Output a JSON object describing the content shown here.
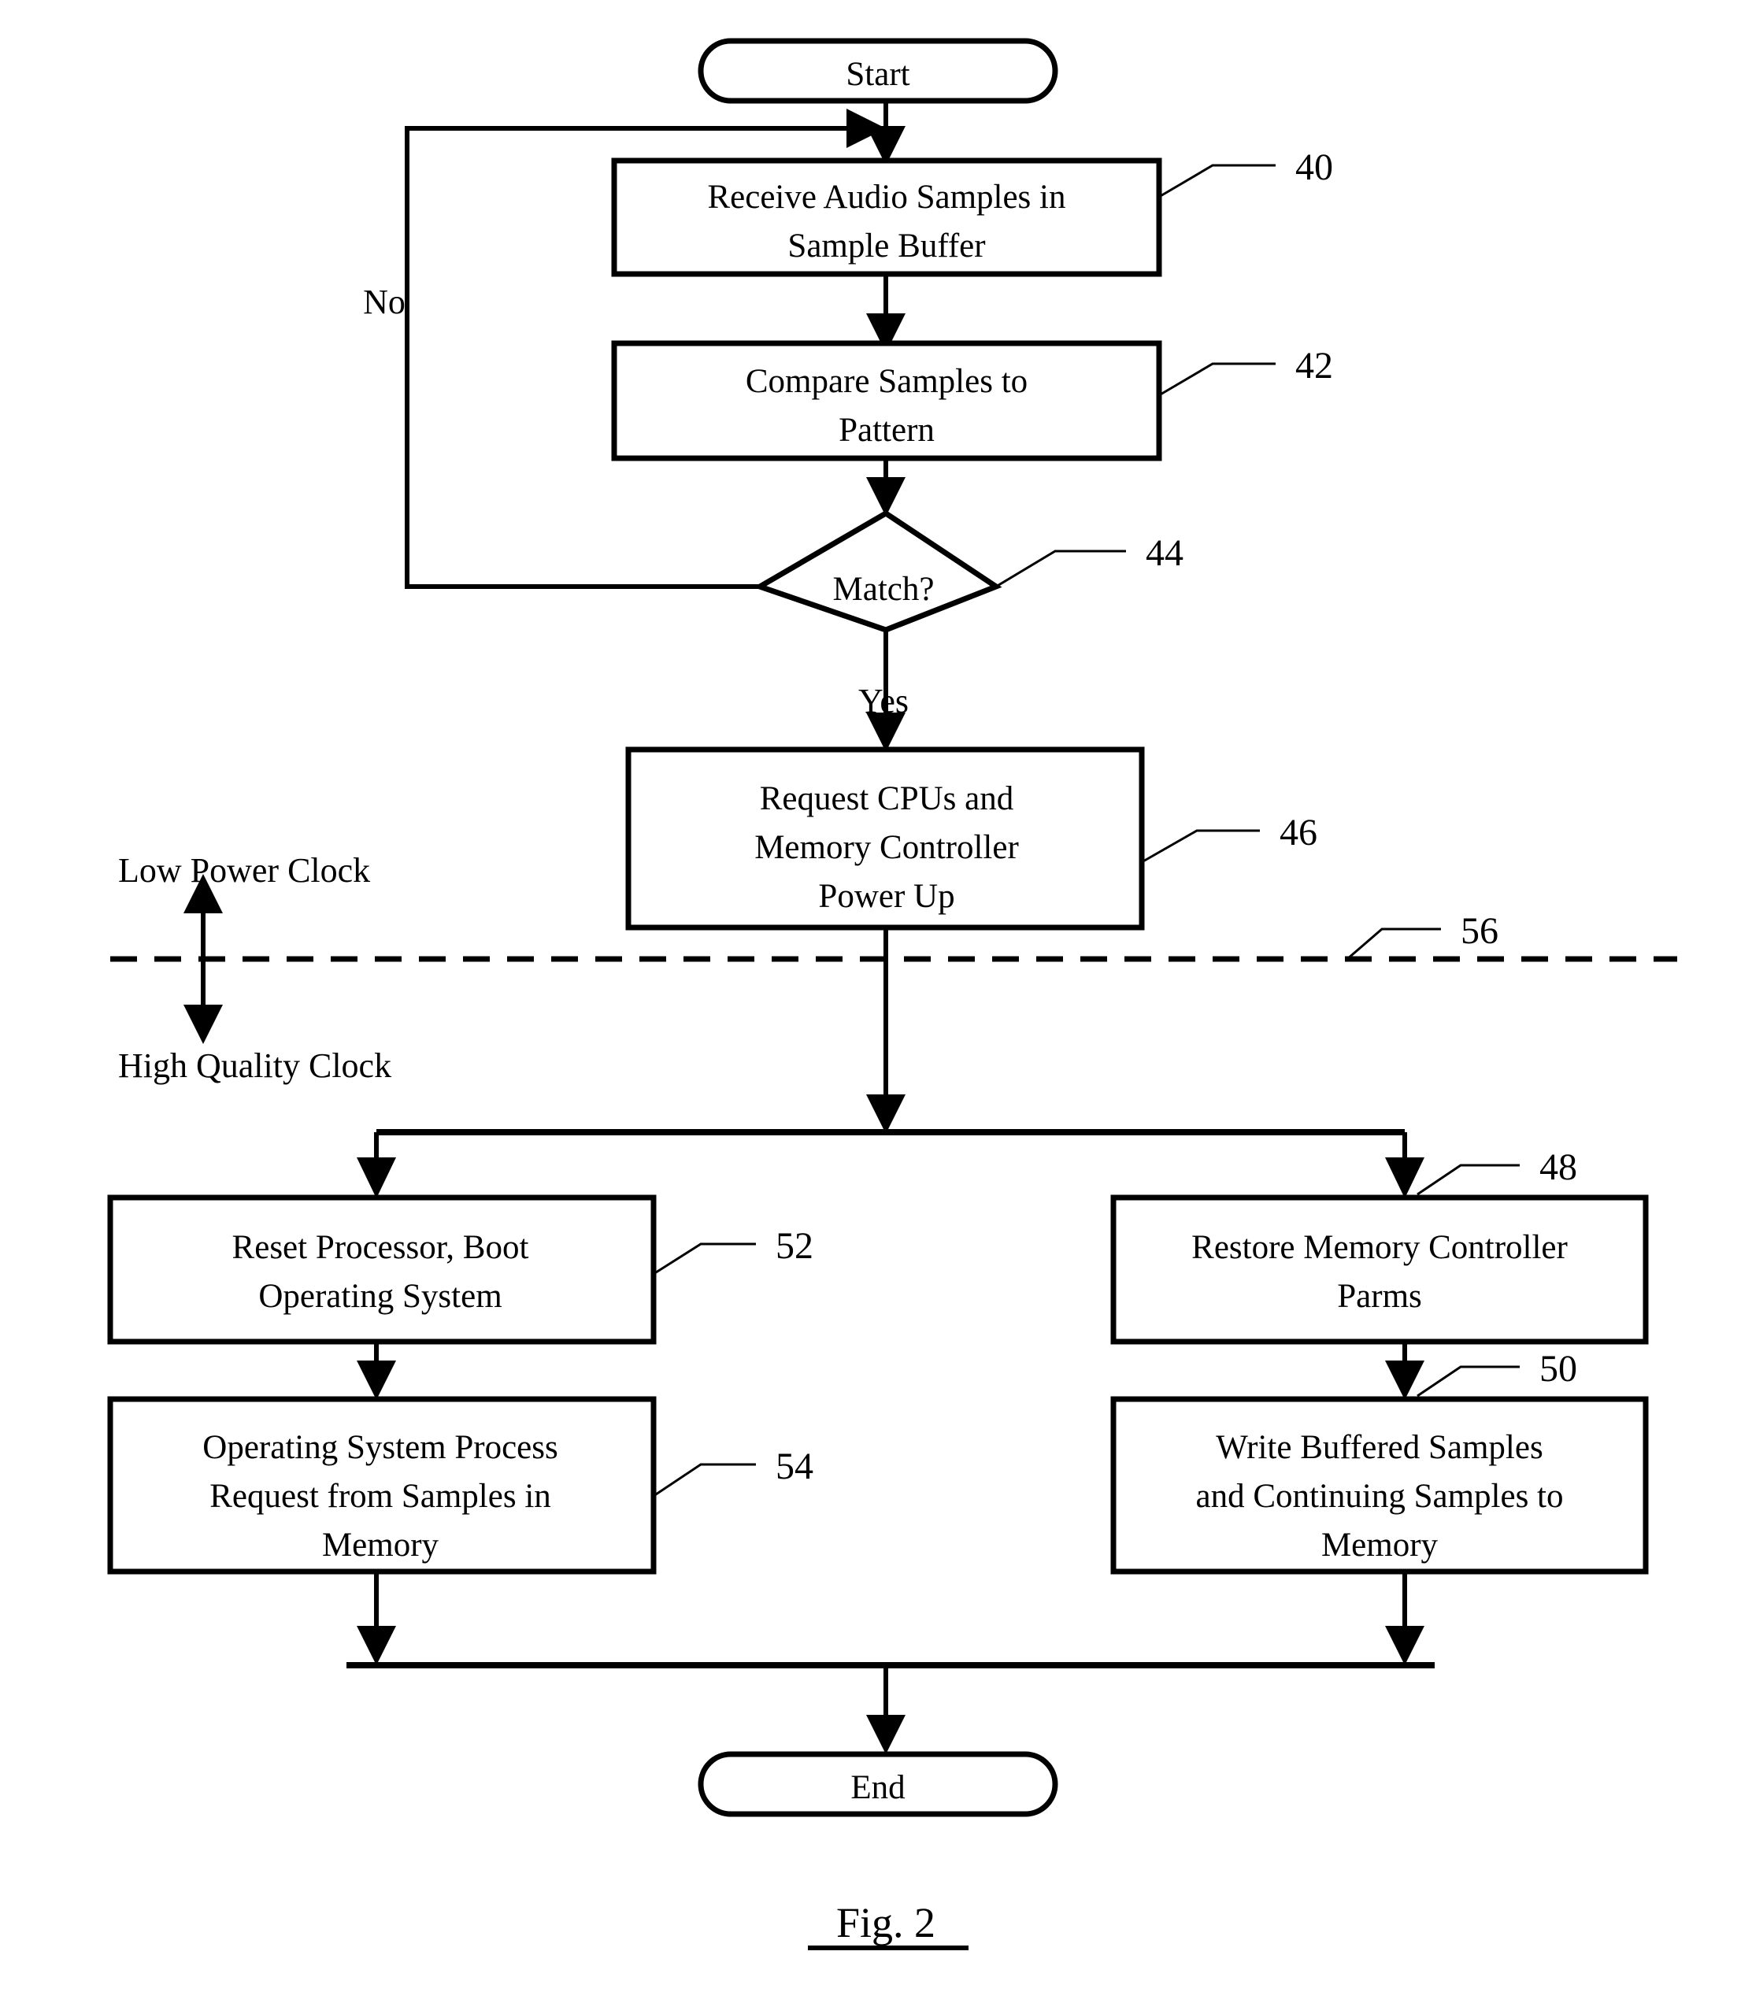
{
  "figure": {
    "caption": "Fig. 2",
    "type": "flowchart"
  },
  "terminators": {
    "start": {
      "label": "Start"
    },
    "end": {
      "label": "End"
    }
  },
  "nodes": [
    {
      "id": "n40",
      "ref": "40",
      "shape": "process",
      "lines": [
        "Receive Audio Samples in",
        "Sample Buffer"
      ]
    },
    {
      "id": "n42",
      "ref": "42",
      "shape": "process",
      "lines": [
        "Compare Samples to",
        "Pattern"
      ]
    },
    {
      "id": "n44",
      "ref": "44",
      "shape": "decision",
      "lines": [
        "Match?"
      ]
    },
    {
      "id": "n46",
      "ref": "46",
      "shape": "process",
      "lines": [
        "Request CPUs and",
        "Memory Controller",
        "Power Up"
      ]
    },
    {
      "id": "n52",
      "ref": "52",
      "shape": "process",
      "lines": [
        "Reset Processor, Boot",
        "Operating System"
      ]
    },
    {
      "id": "n54",
      "ref": "54",
      "shape": "process",
      "lines": [
        "Operating System Process",
        "Request from Samples in",
        "Memory"
      ]
    },
    {
      "id": "n48",
      "ref": "48",
      "shape": "process",
      "lines": [
        "Restore Memory Controller",
        "Parms"
      ]
    },
    {
      "id": "n50",
      "ref": "50",
      "shape": "process",
      "lines": [
        "Write Buffered Samples",
        "and Continuing Samples to",
        "Memory"
      ]
    }
  ],
  "edge_labels": {
    "no": "No",
    "yes": "Yes"
  },
  "clock_divider": {
    "ref": "56",
    "above_label": "Low Power Clock",
    "below_label": "High Quality Clock"
  },
  "colors": {
    "stroke": "#000000",
    "background": "#ffffff"
  }
}
